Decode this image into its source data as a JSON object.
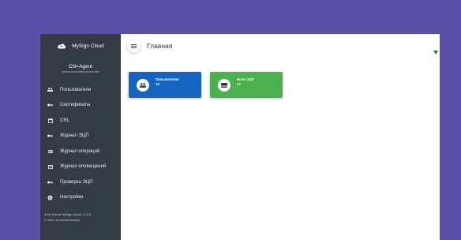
{
  "brand": {
    "name": "MySign Cloud"
  },
  "agent": {
    "name": "CN=Agent",
    "id": "0000070cb4ad7086a702289175d0"
  },
  "sidebar": {
    "items": [
      {
        "label": "Пользователи",
        "icon": "users-icon"
      },
      {
        "label": "Сертификаты",
        "icon": "key-icon"
      },
      {
        "label": "CRL",
        "icon": "calendar-icon"
      },
      {
        "label": "Журнал ЭЦП",
        "icon": "key-icon"
      },
      {
        "label": "Журнал операций",
        "icon": "list-icon"
      },
      {
        "label": "Журнал оповещений",
        "icon": "mail-icon"
      },
      {
        "label": "Проверка ЭЦП",
        "icon": "key-icon"
      },
      {
        "label": "Настройки",
        "icon": "gear-icon"
      }
    ],
    "footer_line1": "АРМ Агента 'MySign Cloud' 1.13.0",
    "footer_line2": "© 2020, Ak Kamal Security"
  },
  "header": {
    "title": "Главная"
  },
  "cards": [
    {
      "title": "Пользователи",
      "count": "10",
      "color": "#1565c0",
      "icon": "users-icon"
    },
    {
      "title": "Всего ЭЦП",
      "count": "17",
      "color": "#4caf50",
      "icon": "card-icon"
    }
  ],
  "colors": {
    "background": "#5a50a6",
    "sidebar": "#333c44",
    "status": "#2e7d32"
  }
}
